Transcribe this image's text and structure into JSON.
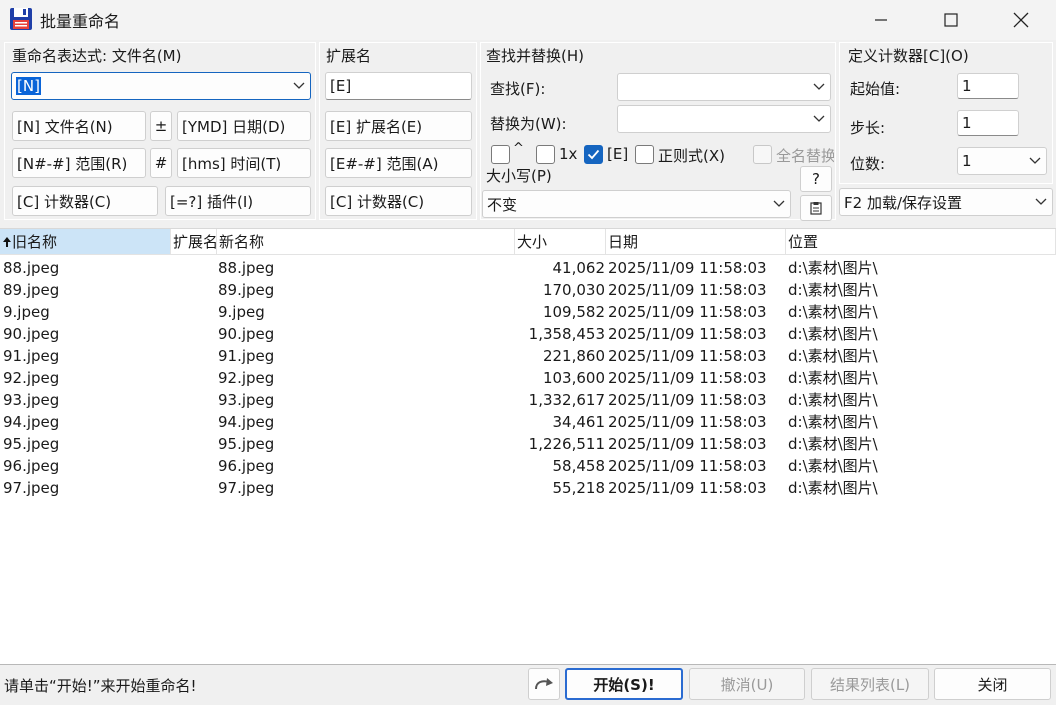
{
  "window": {
    "title": "批量重命名",
    "minimize": "minimize",
    "maximize": "maximize",
    "close": "close"
  },
  "rename_expr": {
    "label": "重命名表达式: 文件名(M)",
    "value": "[N]",
    "buttons": [
      "[N] 文件名(N)",
      "±",
      "[YMD] 日期(D)",
      "[N#-#] 范围(R)",
      "#",
      "[hms] 时间(T)",
      "[C] 计数器(C)",
      "[=?] 插件(I)"
    ]
  },
  "extension": {
    "label": "扩展名",
    "value": "[E]",
    "buttons": [
      "[E] 扩展名(E)",
      "[E#-#] 范围(A)",
      "[C] 计数器(C)"
    ]
  },
  "find_replace": {
    "label": "查找并替换(H)",
    "find_label": "查找(F):",
    "find_value": "",
    "replace_label": "替换为(W):",
    "replace_value": "",
    "checks": [
      {
        "label": "^",
        "checked": false
      },
      {
        "label": "1x",
        "checked": false
      },
      {
        "label": "[E]",
        "checked": true
      },
      {
        "label": "正则式(X)",
        "checked": false
      },
      {
        "label": "全名替换",
        "checked": false,
        "disabled": true
      }
    ],
    "case_label": "大小写(P)",
    "case_value": "不变",
    "help_button": "?"
  },
  "counter": {
    "label": "定义计数器[C](O)",
    "start_label": "起始值:",
    "start_value": "1",
    "step_label": "步长:",
    "step_value": "1",
    "digits_label": "位数:",
    "digits_value": "1",
    "settings_value": "F2 加载/保存设置"
  },
  "list": {
    "columns": [
      "旧名称",
      "扩展名",
      "新名称",
      "大小",
      "日期",
      "位置"
    ],
    "rows": [
      {
        "old": "88.jpeg",
        "new": "88.jpeg",
        "size": "41,062",
        "date": "2025/11/09 11:58:03",
        "path": "d:\\素材\\图片\\"
      },
      {
        "old": "89.jpeg",
        "new": "89.jpeg",
        "size": "170,030",
        "date": "2025/11/09 11:58:03",
        "path": "d:\\素材\\图片\\"
      },
      {
        "old": "9.jpeg",
        "new": "9.jpeg",
        "size": "109,582",
        "date": "2025/11/09 11:58:03",
        "path": "d:\\素材\\图片\\"
      },
      {
        "old": "90.jpeg",
        "new": "90.jpeg",
        "size": "1,358,453",
        "date": "2025/11/09 11:58:03",
        "path": "d:\\素材\\图片\\"
      },
      {
        "old": "91.jpeg",
        "new": "91.jpeg",
        "size": "221,860",
        "date": "2025/11/09 11:58:03",
        "path": "d:\\素材\\图片\\"
      },
      {
        "old": "92.jpeg",
        "new": "92.jpeg",
        "size": "103,600",
        "date": "2025/11/09 11:58:03",
        "path": "d:\\素材\\图片\\"
      },
      {
        "old": "93.jpeg",
        "new": "93.jpeg",
        "size": "1,332,617",
        "date": "2025/11/09 11:58:03",
        "path": "d:\\素材\\图片\\"
      },
      {
        "old": "94.jpeg",
        "new": "94.jpeg",
        "size": "34,461",
        "date": "2025/11/09 11:58:03",
        "path": "d:\\素材\\图片\\"
      },
      {
        "old": "95.jpeg",
        "new": "95.jpeg",
        "size": "1,226,511",
        "date": "2025/11/09 11:58:03",
        "path": "d:\\素材\\图片\\"
      },
      {
        "old": "96.jpeg",
        "new": "96.jpeg",
        "size": "58,458",
        "date": "2025/11/09 11:58:03",
        "path": "d:\\素材\\图片\\"
      },
      {
        "old": "97.jpeg",
        "new": "97.jpeg",
        "size": "55,218",
        "date": "2025/11/09 11:58:03",
        "path": "d:\\素材\\图片\\"
      }
    ]
  },
  "status": {
    "message": "请单击“开始!”来开始重命名!",
    "start": "开始(S)!",
    "undo": "撤消(U)",
    "results": "结果列表(L)",
    "close": "关闭"
  },
  "colors": {
    "accent": "#1565c0",
    "sorted_header": "#cce4f7",
    "selection": "#0a64d8"
  }
}
